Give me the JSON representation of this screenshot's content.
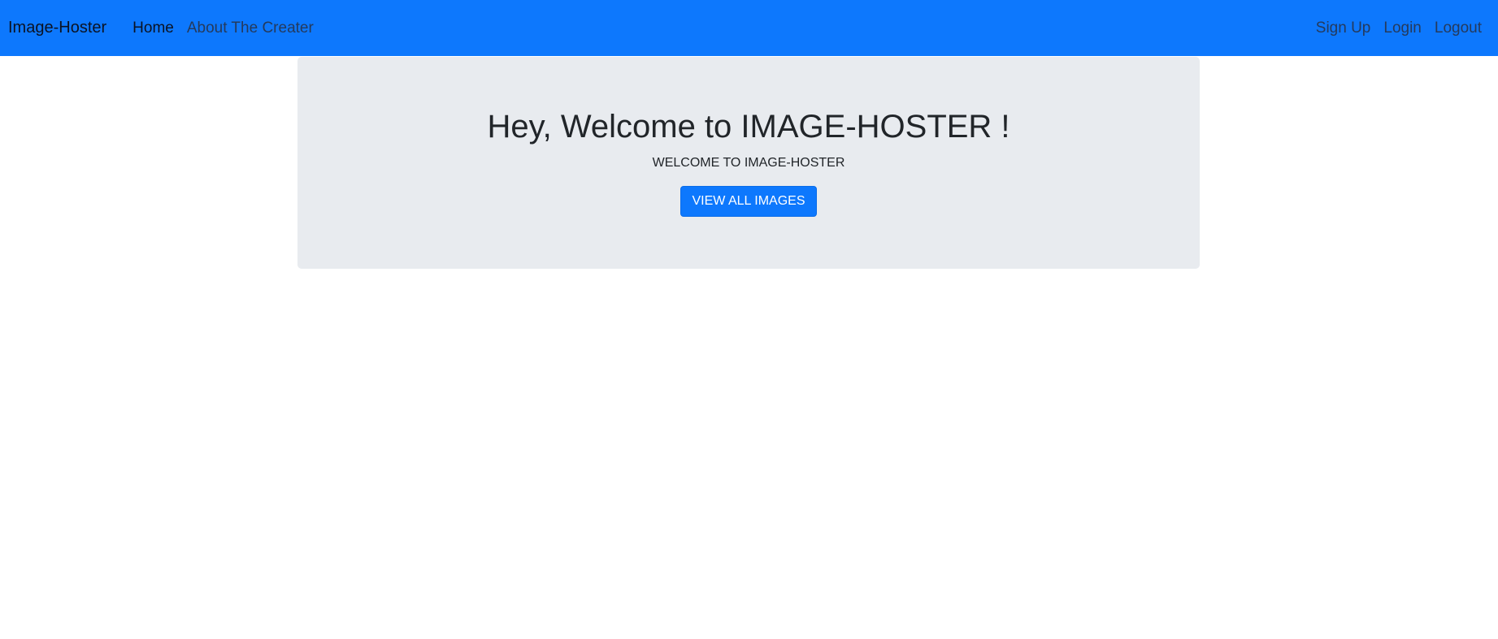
{
  "navbar": {
    "brand": "Image-Hoster",
    "left_links": [
      {
        "label": "Home",
        "active": true
      },
      {
        "label": "About The Creater",
        "active": false
      }
    ],
    "right_links": [
      {
        "label": "Sign Up"
      },
      {
        "label": "Login"
      },
      {
        "label": "Logout"
      }
    ]
  },
  "hero": {
    "title": "Hey, Welcome to IMAGE-HOSTER !",
    "subtitle": "WELCOME TO IMAGE-HOSTER",
    "button_label": "VIEW ALL IMAGES"
  },
  "colors": {
    "navbar_bg": "#0d78fd",
    "jumbotron_bg": "#e8ebef",
    "button_bg": "#0d78fd"
  }
}
